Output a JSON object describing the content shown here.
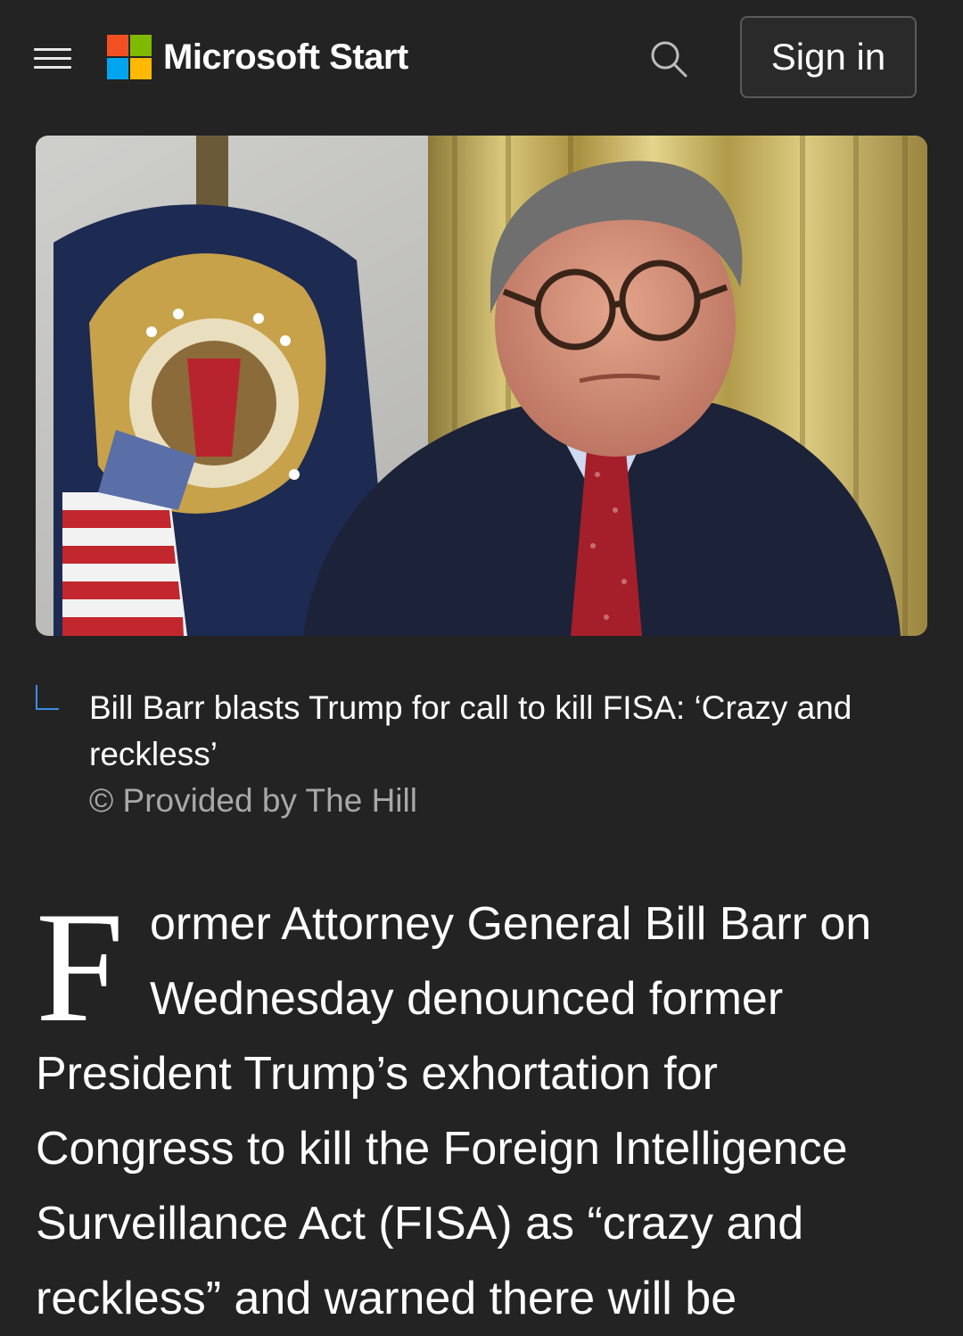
{
  "header": {
    "brand": "Microsoft Start",
    "sign_in_label": "Sign in",
    "menu_icon": "hamburger-menu-icon",
    "search_icon": "search-icon",
    "logo_colors": [
      "#f25022",
      "#7fba00",
      "#00a4ef",
      "#ffb900"
    ]
  },
  "article": {
    "image_caption": "Bill Barr blasts Trump for call to kill FISA: ‘Crazy and reckless’",
    "image_credit": "© Provided by The Hill",
    "drop_cap": "F",
    "body_lines": [
      "ormer Attorney General Bill Barr on",
      "Wednesday denounced former",
      "President Trump’s exhortation for",
      "Congress to kill the Foreign Intelligence",
      "Surveillance Act (FISA) as “crazy and",
      "reckless” and warned there will be"
    ]
  },
  "theme": {
    "background": "#232323",
    "accent": "#3a8ee6",
    "muted_text": "#a8a8a8"
  }
}
